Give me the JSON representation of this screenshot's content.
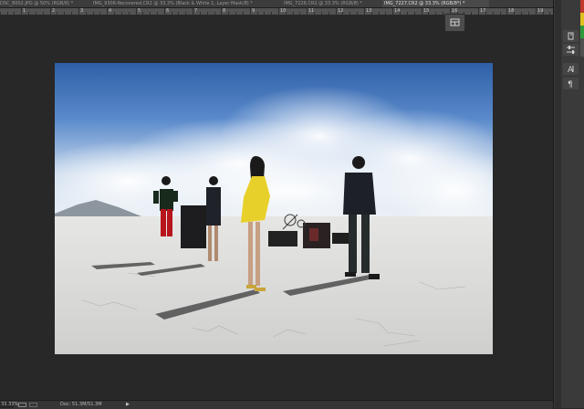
{
  "tabs": [
    {
      "label": "DSC_8002.JPG @ 50% (RGB/8) *",
      "active": false
    },
    {
      "label": "IMG_9306-Recovered.CR2 @ 33.3% (Black & White 1, Layer Mask/8) *",
      "active": false
    },
    {
      "label": "IMG_7226.CR2 @ 33.3% (RGB/8) *",
      "active": false
    },
    {
      "label": "IMG_7227.CR2 @ 33.3% (RGB/8*) *",
      "active": true
    }
  ],
  "ruler": {
    "labels": [
      "0",
      "1",
      "2",
      "3",
      "4",
      "5",
      "6",
      "7",
      "8",
      "9",
      "10",
      "11",
      "12",
      "13",
      "14",
      "15",
      "16",
      "17",
      "18",
      "19"
    ]
  },
  "status": {
    "zoom": "33.33%",
    "doc_info": "Doc: 51.3M/51.3M"
  },
  "colors": {
    "canvas_bg": "#282828",
    "panel_bg": "#3a3a3a",
    "accent_red": "#c0392b",
    "accent_yellow": "#e0c020",
    "accent_green": "#2e9a3a"
  },
  "icons": [
    "arrange-documents-icon",
    "history-icon",
    "adjustments-icon",
    "character-icon",
    "paragraph-icon"
  ]
}
